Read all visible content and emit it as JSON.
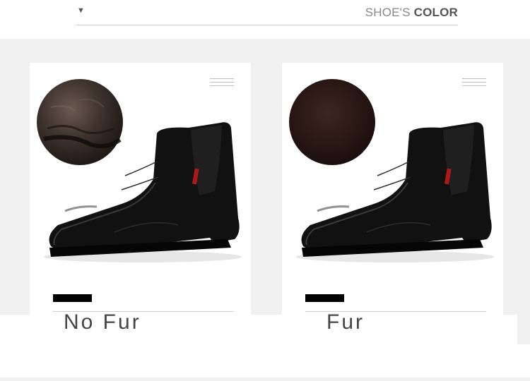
{
  "header": {
    "dropdown_arrow": "▼",
    "title_prefix": "SHOE'S",
    "title_emphasis": "COLOR"
  },
  "options": [
    {
      "label": "No Fur",
      "swatch": "leather-lining-swatch",
      "color": "#3e322d"
    },
    {
      "label": "Fur",
      "swatch": "fur-lining-swatch",
      "color": "#2a1815"
    }
  ],
  "colors": {
    "background": "#f0f0f0",
    "card": "#ffffff",
    "accent": "#000000"
  }
}
